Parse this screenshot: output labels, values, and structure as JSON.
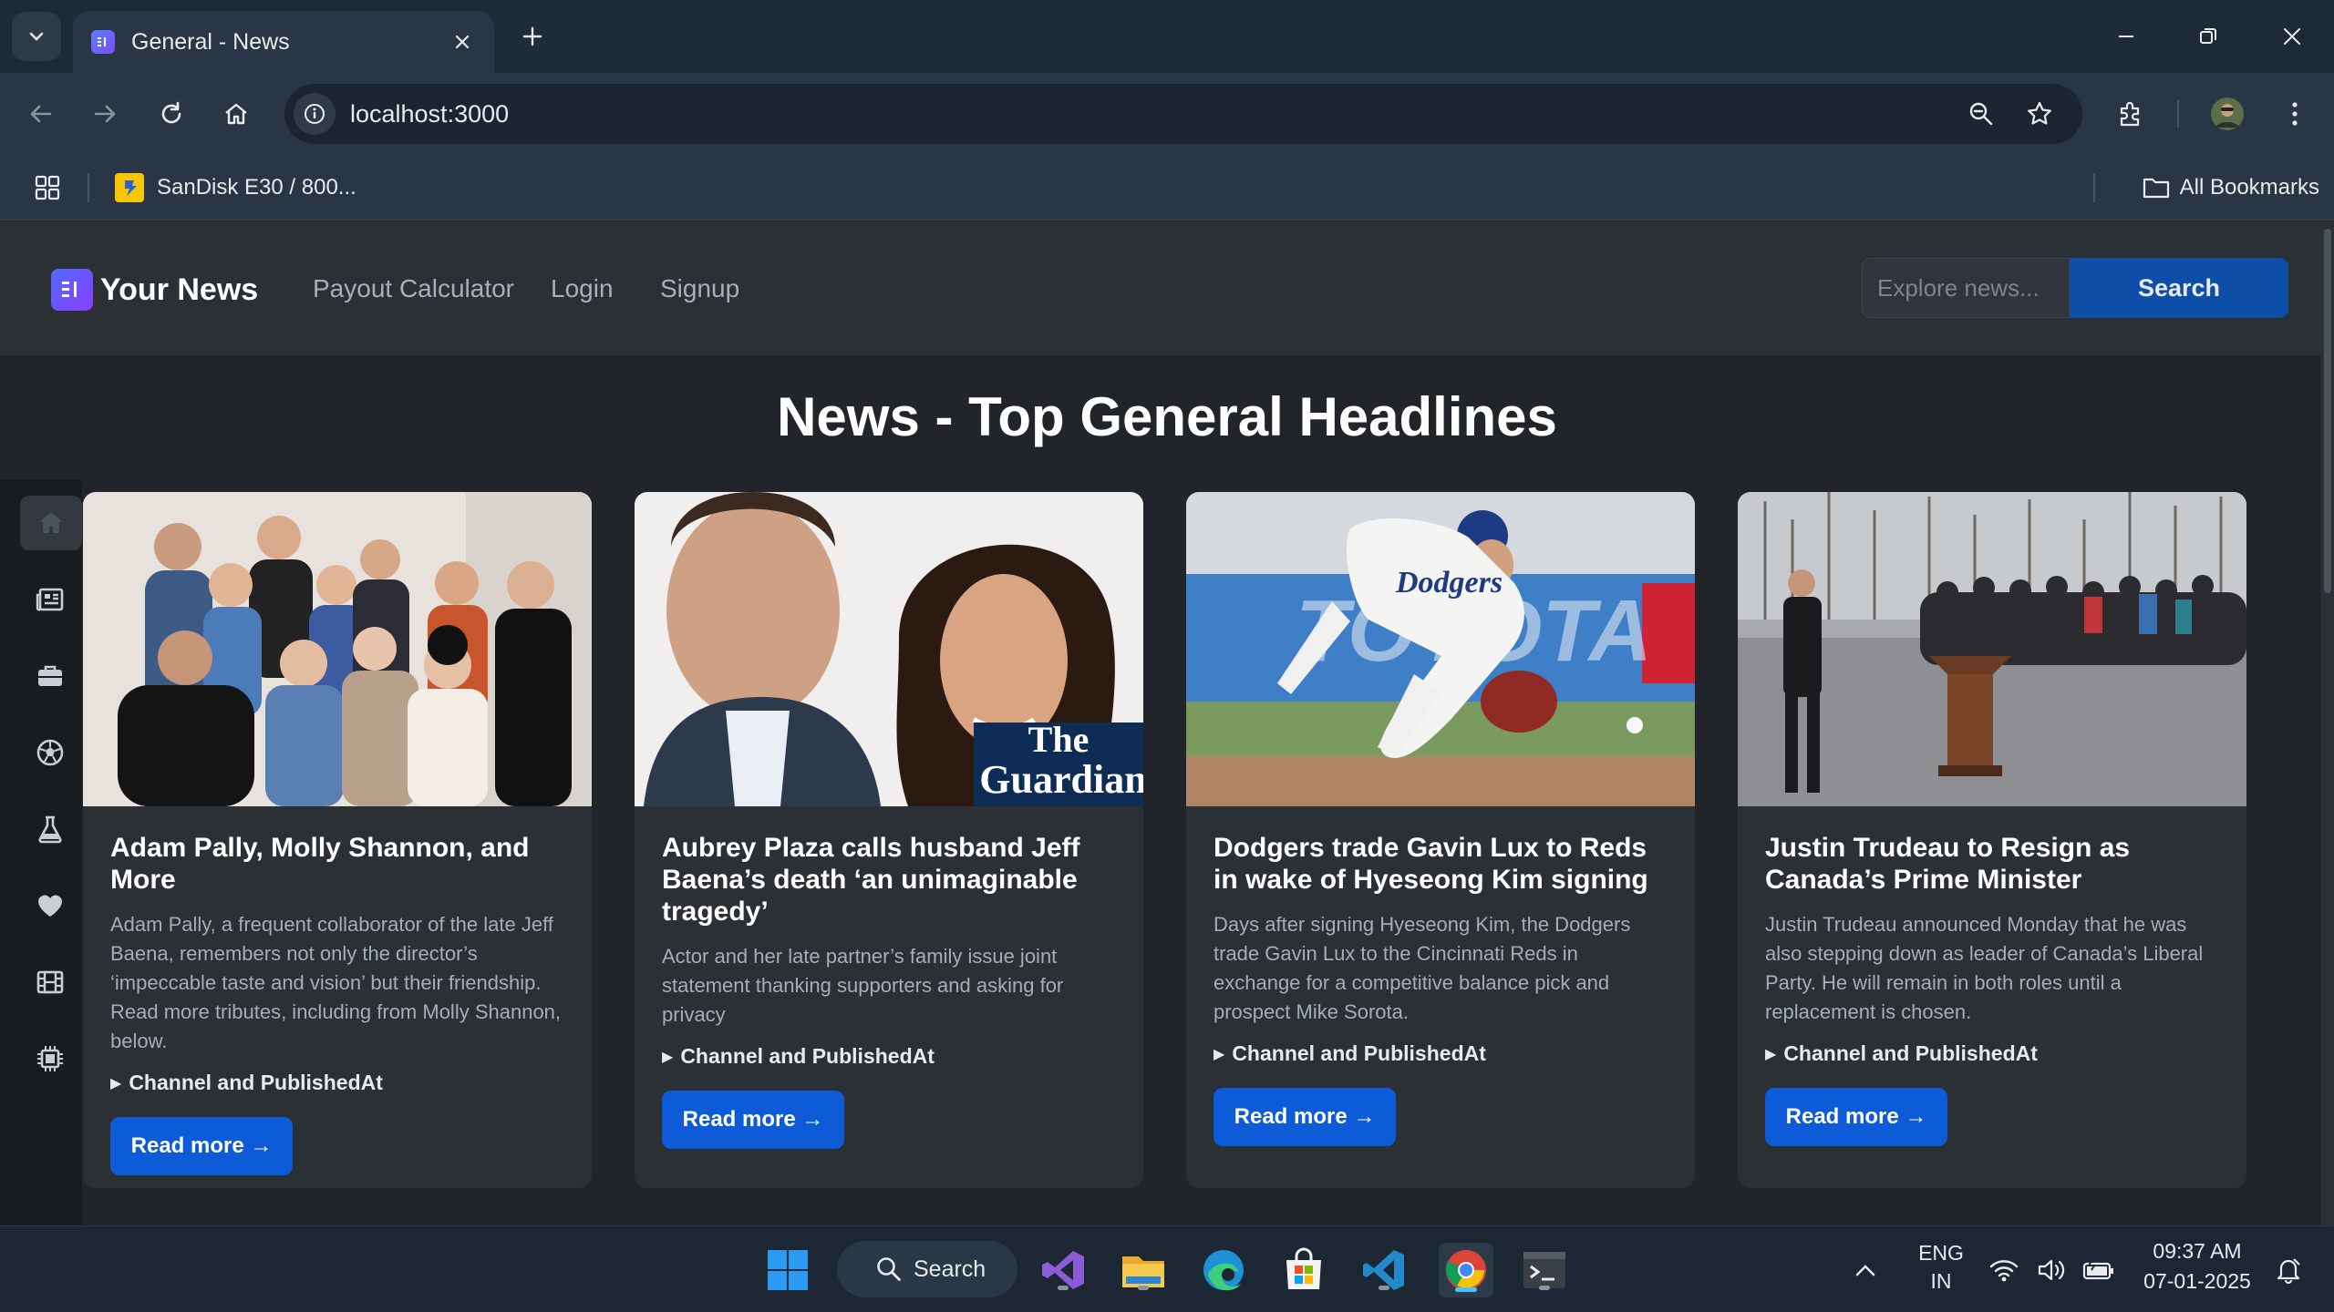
{
  "browser": {
    "tab_title": "General - News",
    "url": "localhost:3000",
    "bookmark_label": "SanDisk E30 / 800...",
    "all_bookmarks": "All Bookmarks"
  },
  "navbar": {
    "brand": "Your News",
    "links": [
      "Payout Calculator",
      "Login",
      "Signup"
    ],
    "search_placeholder": "Explore news...",
    "search_button": "Search"
  },
  "main": {
    "heading": "News - Top General Headlines",
    "sidebar_icons": [
      "home-icon",
      "newspaper-icon",
      "briefcase-icon",
      "soccer-ball-icon",
      "flask-icon",
      "heart-icon",
      "film-icon",
      "chip-icon"
    ],
    "cards": [
      {
        "title": "Adam Pally, Molly Shannon, and More",
        "description": "Adam Pally, a frequent collaborator of the late Jeff Baena, remembers not only the director’s ‘impeccable taste and vision’ but their friendship. Read more tributes, including from Molly Shannon, below.",
        "details": "Channel and PublishedAt",
        "button": "Read more →"
      },
      {
        "title": "Aubrey Plaza calls husband Jeff Baena’s death ‘an unimaginable tragedy’",
        "description": "Actor and her late partner’s family issue joint statement thanking supporters and asking for privacy",
        "details": "Channel and PublishedAt",
        "button": "Read more →",
        "image_logo": "The Guardian"
      },
      {
        "title": "Dodgers trade Gavin Lux to Reds in wake of Hyeseong Kim signing",
        "description": "Days after signing Hyeseong Kim, the Dodgers trade Gavin Lux to the Cincinnati Reds in exchange for a competitive balance pick and prospect Mike Sorota.",
        "details": "Channel and PublishedAt",
        "button": "Read more →"
      },
      {
        "title": "Justin Trudeau to Resign as Canada’s Prime Minister",
        "description": "Justin Trudeau announced Monday that he was also stepping down as leader of Canada’s Liberal Party. He will remain in both roles until a replacement is chosen.",
        "details": "Channel and PublishedAt",
        "button": "Read more →"
      }
    ]
  },
  "taskbar": {
    "search_label": "Search",
    "lang_line1": "ENG",
    "lang_line2": "IN",
    "time": "09:37 AM",
    "date": "07-01-2025"
  },
  "colors": {
    "accent": "#0d5bd7",
    "page_bg": "#212529",
    "card_bg": "#2b3035",
    "navbar_bg": "#2b3035"
  }
}
